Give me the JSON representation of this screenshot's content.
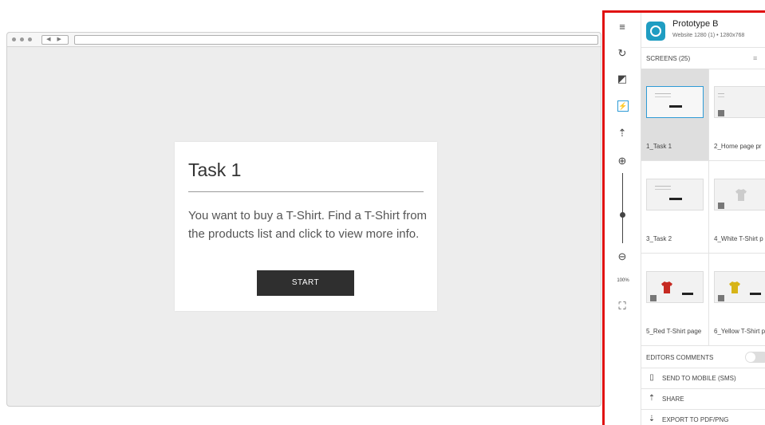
{
  "browser": {
    "nav_arrows": "◀ ▶"
  },
  "task_card": {
    "title": "Task 1",
    "description": "You want to buy a T-Shirt. Find a T-Shirt from the products list and click to view more info.",
    "start_label": "START"
  },
  "toolbar": {
    "icons": [
      "menu-icon",
      "refresh-icon",
      "contrast-icon",
      "hotspot-icon",
      "broadcast-icon",
      "zoom-in-icon",
      "zoom-out-icon",
      "fullscreen-icon"
    ],
    "zoom_level": "100%",
    "glyphs": {
      "menu": "≡",
      "refresh": "↻",
      "contrast": "◩",
      "hotspot": "⚡",
      "broadcast": "⇡",
      "zoom_in": "⊕",
      "zoom_out": "⊖",
      "fullscreen": "⛶"
    }
  },
  "project": {
    "name": "Prototype B",
    "subtitle": "Website 1280 (1) • 1280x768"
  },
  "screens": {
    "header": "SCREENS (25)",
    "items": [
      {
        "label": "1_Task 1",
        "selected": true
      },
      {
        "label": "2_Home page pr",
        "selected": false
      },
      {
        "label": "3_Task 2",
        "selected": false
      },
      {
        "label": "4_White T-Shirt p",
        "selected": false
      },
      {
        "label": "5_Red T-Shirt page",
        "selected": false
      },
      {
        "label": "6_Yellow T-Shirt p",
        "selected": false
      }
    ]
  },
  "actions": {
    "editors_comments": "EDITORS COMMENTS",
    "send_to_mobile": "SEND TO MOBILE (SMS)",
    "share": "SHARE",
    "export": "EXPORT TO PDF/PNG"
  },
  "colors": {
    "accent": "#1f9dc2",
    "highlight_border": "#e01010",
    "start_button": "#2f2f2f",
    "shirt_white": "#cccccc",
    "shirt_red": "#c62a22",
    "shirt_yellow": "#d7b417"
  }
}
